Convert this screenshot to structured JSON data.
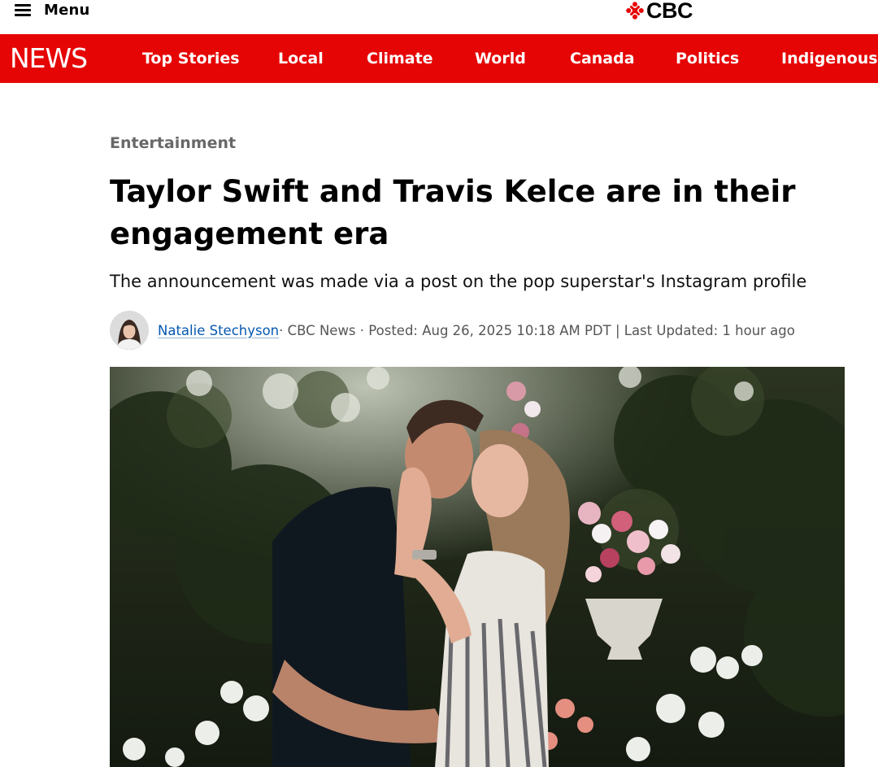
{
  "header": {
    "menu_label": "Menu",
    "logo_text": "CBC",
    "brand_color": "#e60505"
  },
  "nav": {
    "section_logo": "NEWS",
    "items": [
      "Top Stories",
      "Local",
      "Climate",
      "World",
      "Canada",
      "Politics",
      "Indigenous"
    ]
  },
  "article": {
    "category": "Entertainment",
    "headline": "Taylor Swift and Travis Kelce are in their engagement era",
    "dek": "The announcement was made via a post on the pop superstar's Instagram profile",
    "byline": {
      "author": "Natalie Stechyson",
      "meta": " · CBC News · Posted: Aug 26, 2025 10:18 AM PDT | Last Updated: 1 hour ago"
    }
  }
}
